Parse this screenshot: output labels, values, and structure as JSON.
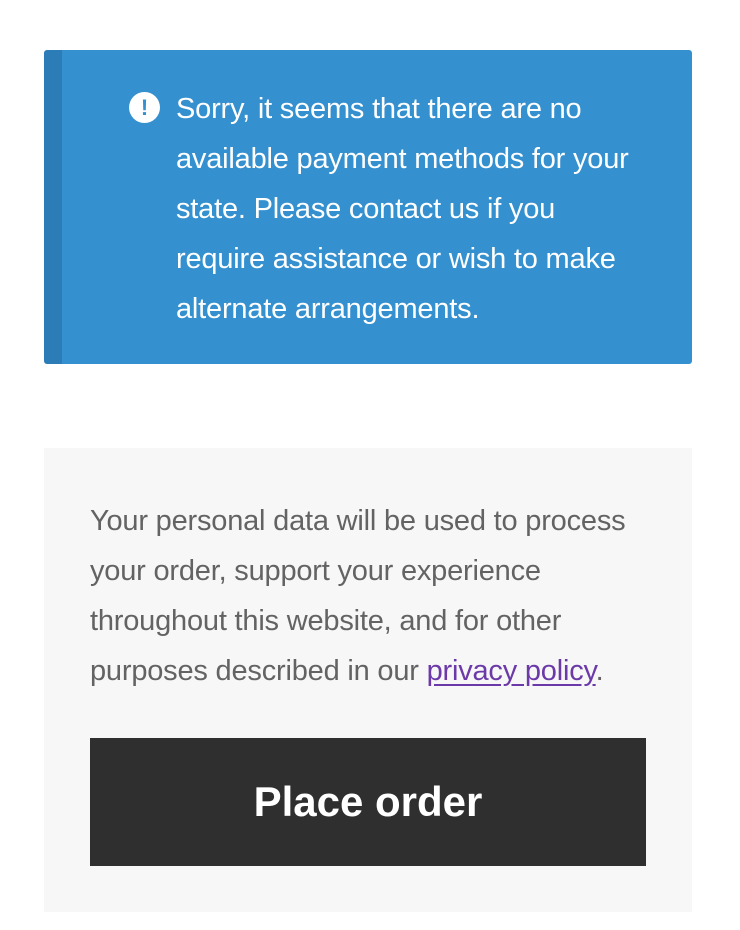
{
  "notice": {
    "icon": "exclamation-circle-icon",
    "message": "Sorry, it seems that there are no available payment methods for your state. Please contact us if you require assistance or wish to make alternate arrangements.",
    "colors": {
      "background": "#3490cf",
      "accent_border": "#2b7cb7",
      "text": "#ffffff"
    }
  },
  "checkout": {
    "privacy_text_before": "Your personal data will be used to process your order, support your experience throughout this website, and for other purposes described in our ",
    "privacy_link_label": "privacy policy",
    "privacy_text_after": ".",
    "place_order_label": "Place order",
    "colors": {
      "box_background": "#f7f7f7",
      "link": "#6b3aa8",
      "button_background": "#2f2f2f"
    }
  }
}
